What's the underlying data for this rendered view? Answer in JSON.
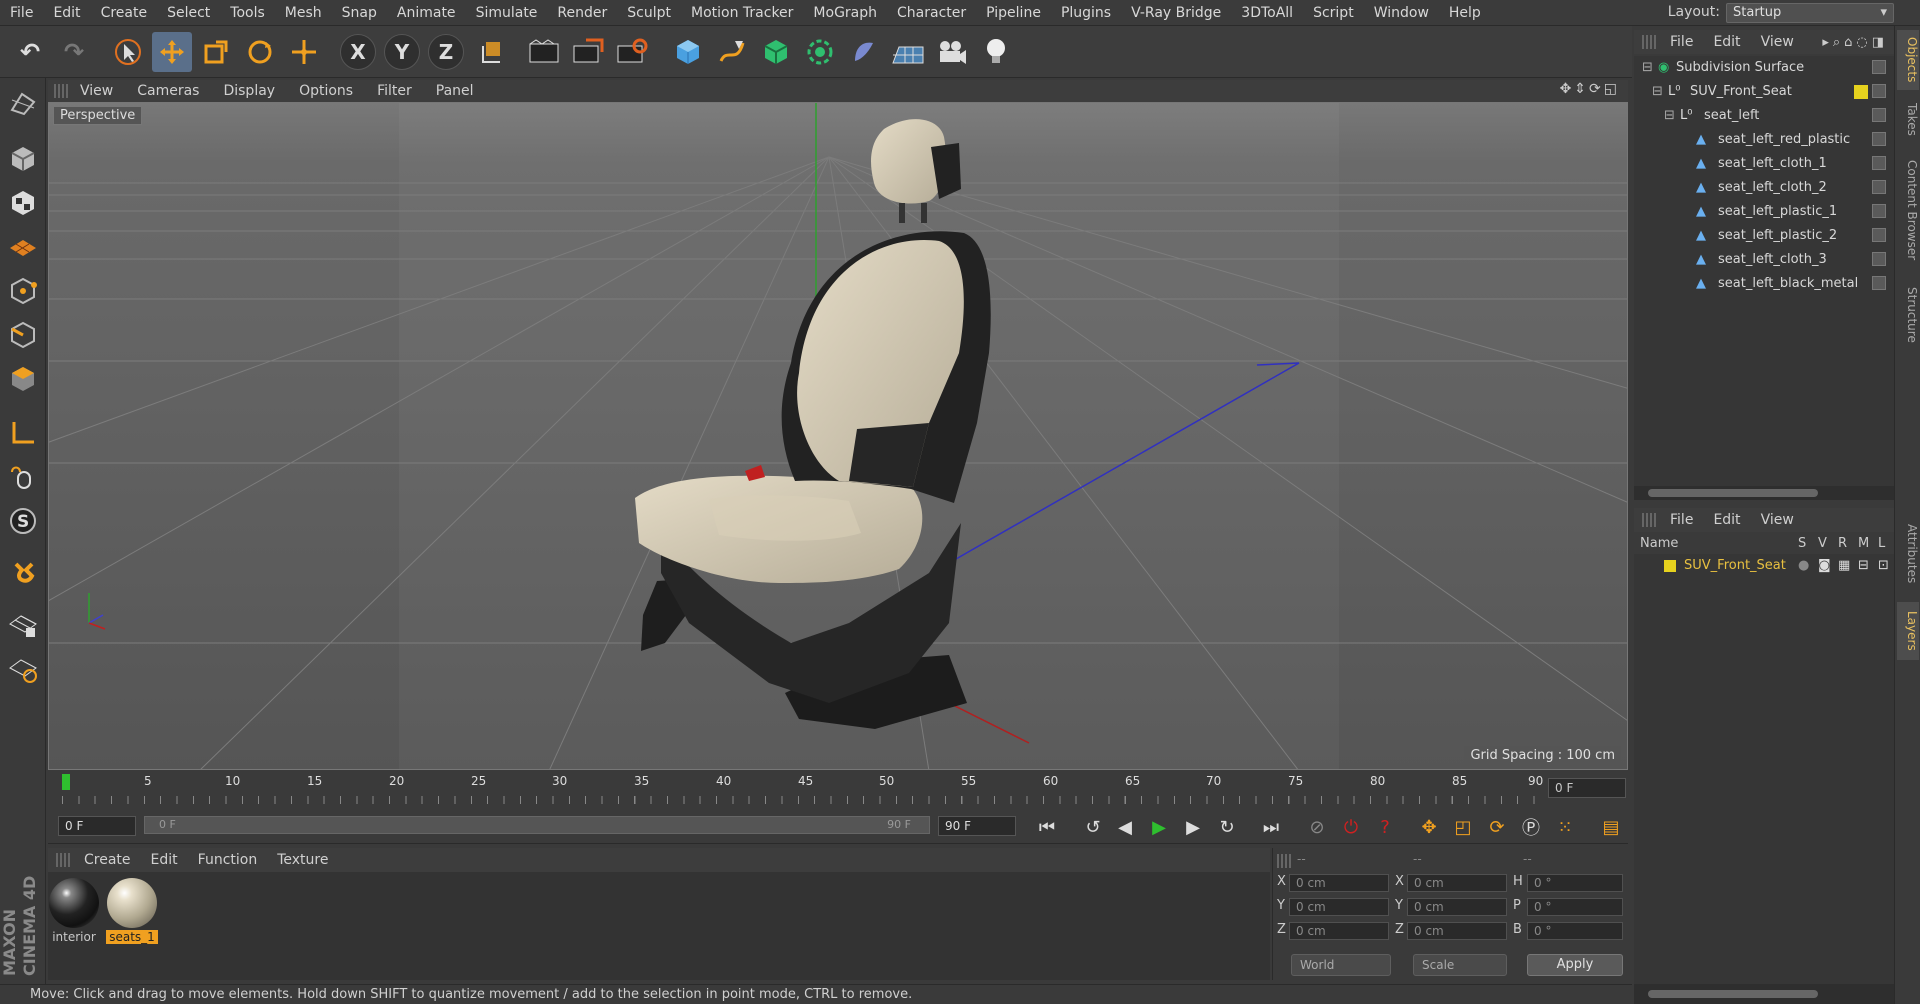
{
  "menubar": {
    "items": [
      "File",
      "Edit",
      "Create",
      "Select",
      "Tools",
      "Mesh",
      "Snap",
      "Animate",
      "Simulate",
      "Render",
      "Sculpt",
      "Motion Tracker",
      "MoGraph",
      "Character",
      "Pipeline",
      "Plugins",
      "V-Ray Bridge",
      "3DToAll",
      "Script",
      "Window",
      "Help"
    ],
    "layout_label": "Layout:",
    "layout_value": "Startup"
  },
  "viewport": {
    "menu": [
      "View",
      "Cameras",
      "Display",
      "Options",
      "Filter",
      "Panel"
    ],
    "label": "Perspective",
    "grid_spacing": "Grid Spacing : 100 cm"
  },
  "timeline": {
    "ticks": [
      "0",
      "5",
      "10",
      "15",
      "20",
      "25",
      "30",
      "35",
      "40",
      "45",
      "50",
      "55",
      "60",
      "65",
      "70",
      "75",
      "80",
      "85",
      "90"
    ],
    "current_frame": "0 F",
    "start_field": "0 F",
    "range_start": "0 F",
    "range_end": "90 F",
    "end_field": "90 F"
  },
  "materials": {
    "menu": [
      "Create",
      "Edit",
      "Function",
      "Texture"
    ],
    "items": [
      {
        "name": "interior"
      },
      {
        "name": "seats_1"
      }
    ]
  },
  "coordinates": {
    "header": [
      "--",
      "--",
      "--"
    ],
    "rows": [
      {
        "a1": "X",
        "v1": "0 cm",
        "a2": "X",
        "v2": "0 cm",
        "a3": "H",
        "v3": "0 °"
      },
      {
        "a1": "Y",
        "v1": "0 cm",
        "a2": "Y",
        "v2": "0 cm",
        "a3": "P",
        "v3": "0 °"
      },
      {
        "a1": "Z",
        "v1": "0 cm",
        "a2": "Z",
        "v2": "0 cm",
        "a3": "B",
        "v3": "0 °"
      }
    ],
    "mode": "World",
    "transform": "Scale",
    "apply": "Apply"
  },
  "status": "Move: Click and drag to move elements. Hold down SHIFT to quantize movement / add to the selection in point mode, CTRL to remove.",
  "objects": {
    "menu": [
      "File",
      "Edit",
      "View"
    ],
    "items": [
      {
        "name": "Subdivision Surface",
        "indent": 0
      },
      {
        "name": "SUV_Front_Seat",
        "indent": 1
      },
      {
        "name": "seat_left",
        "indent": 2
      },
      {
        "name": "seat_left_red_plastic",
        "indent": 3
      },
      {
        "name": "seat_left_cloth_1",
        "indent": 3
      },
      {
        "name": "seat_left_cloth_2",
        "indent": 3
      },
      {
        "name": "seat_left_plastic_1",
        "indent": 3
      },
      {
        "name": "seat_left_plastic_2",
        "indent": 3
      },
      {
        "name": "seat_left_cloth_3",
        "indent": 3
      },
      {
        "name": "seat_left_black_metal",
        "indent": 3
      }
    ]
  },
  "layers": {
    "menu": [
      "File",
      "Edit",
      "View"
    ],
    "columns": [
      "Name",
      "S",
      "V",
      "R",
      "M",
      "L"
    ],
    "items": [
      {
        "name": "SUV_Front_Seat",
        "color": "#e6d21e"
      }
    ]
  },
  "side_tabs": [
    "Objects",
    "Takes",
    "Content Browser",
    "Structure",
    "Attributes",
    "Layers"
  ],
  "brand": "MAXON CINEMA 4D",
  "colors": {
    "accent_selected": "#5a6f8a",
    "playhead": "#2fbf2f",
    "layer_yellow": "#e6d21e",
    "material_selected": "#f0a020"
  }
}
